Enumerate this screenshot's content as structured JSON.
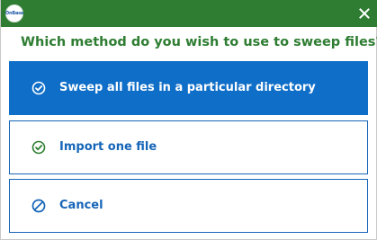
{
  "window": {
    "logo_text": "OnBase",
    "close_icon": "close-icon",
    "accent_color": "#2e7d32"
  },
  "dialog": {
    "question": "Which method do you wish to use to sweep files?",
    "options": [
      {
        "label": "Sweep all files in a particular directory",
        "icon": "check-circle-icon",
        "selected": true
      },
      {
        "label": "Import one file",
        "icon": "check-circle-icon",
        "selected": false
      },
      {
        "label": "Cancel",
        "icon": "cancel-circle-icon",
        "selected": false
      }
    ],
    "selected_color": "#0f6ec7",
    "link_color": "#1565b8"
  }
}
